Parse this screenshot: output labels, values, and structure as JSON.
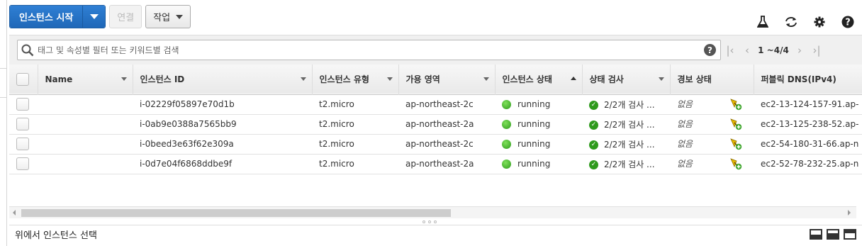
{
  "toolbar": {
    "launch_label": "인스턴스 시작",
    "connect_label": "연결",
    "actions_label": "작업"
  },
  "top_icons": [
    "flask-icon",
    "refresh-icon",
    "gear-icon",
    "help-icon"
  ],
  "filter": {
    "placeholder": "태그 및 속성별 필터 또는 키워드별 검색",
    "help": "?",
    "page_range": "1 ~4/4"
  },
  "table": {
    "columns": [
      "Name",
      "인스턴스 ID",
      "인스턴스 유형",
      "가용 영역",
      "인스턴스 상태",
      "상태 검사",
      "경보 상태",
      "퍼블릭 DNS(IPv4)"
    ],
    "rows": [
      {
        "name": "",
        "id": "i-02229f05897e70d1b",
        "type": "t2.micro",
        "az": "ap-northeast-2c",
        "state": "running",
        "checks": "2/2개 검사 ...",
        "alarm": "없음",
        "dns": "ec2-13-124-157-91.ap-"
      },
      {
        "name": "",
        "id": "i-0ab9e0388a7565bb9",
        "type": "t2.micro",
        "az": "ap-northeast-2a",
        "state": "running",
        "checks": "2/2개 검사 ...",
        "alarm": "없음",
        "dns": "ec2-13-125-238-52.ap-"
      },
      {
        "name": "",
        "id": "i-0beed3e63f62e309a",
        "type": "t2.micro",
        "az": "ap-northeast-2c",
        "state": "running",
        "checks": "2/2개 검사 ...",
        "alarm": "없음",
        "dns": "ec2-54-180-31-66.ap-n"
      },
      {
        "name": "",
        "id": "i-0d7e04f6868ddbe9f",
        "type": "t2.micro",
        "az": "ap-northeast-2a",
        "state": "running",
        "checks": "2/2개 검사 ...",
        "alarm": "없음",
        "dns": "ec2-52-78-232-25.ap-n"
      }
    ]
  },
  "bottom": {
    "label": "위에서 인스턴스 선택"
  },
  "colors": {
    "primary": "#2071c4",
    "running": "#3fb82a"
  }
}
